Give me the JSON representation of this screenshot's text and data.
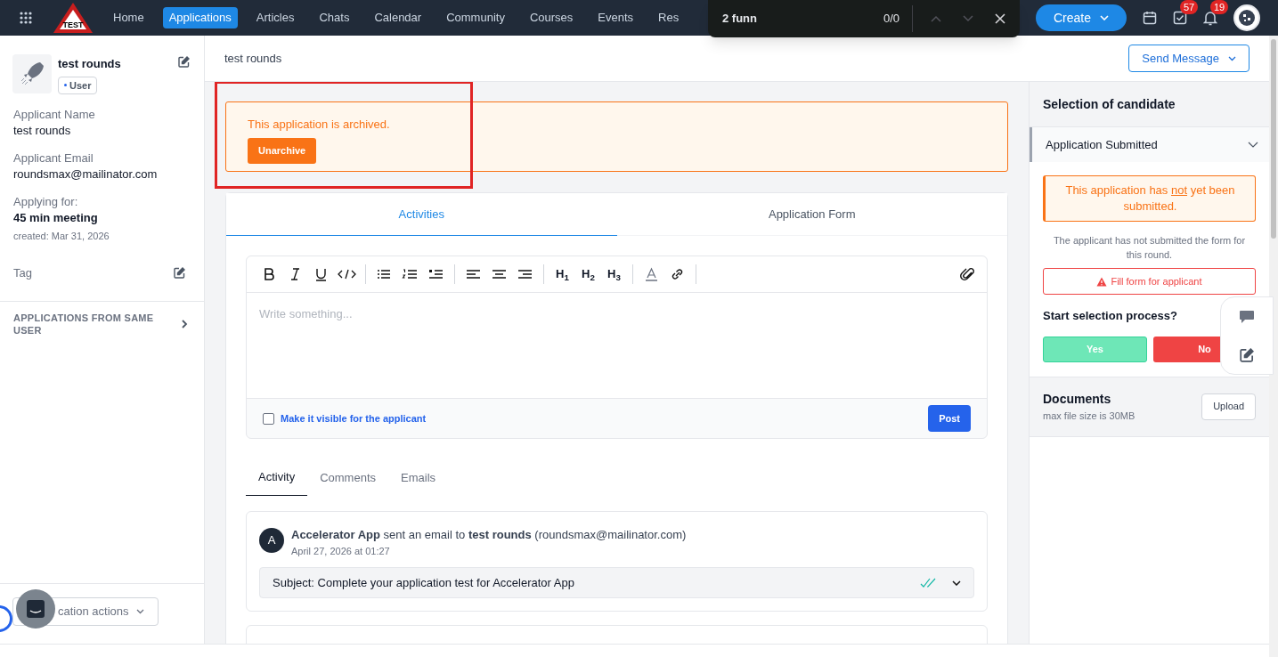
{
  "nav": {
    "items": [
      {
        "label": "Home",
        "selected": false
      },
      {
        "label": "Applications",
        "selected": true
      },
      {
        "label": "Articles",
        "selected": false
      },
      {
        "label": "Chats",
        "selected": false
      },
      {
        "label": "Calendar",
        "selected": false
      },
      {
        "label": "Community",
        "selected": false
      },
      {
        "label": "Courses",
        "selected": false
      },
      {
        "label": "Events",
        "selected": false
      },
      {
        "label": "Res",
        "selected": false
      }
    ],
    "logo": "TEST",
    "create": "Create",
    "tasks_badge": "57",
    "notifications_badge": "19"
  },
  "find_bar": {
    "query": "2 funn",
    "count": "0/0"
  },
  "header": {
    "title": "test rounds",
    "send_message": "Send Message"
  },
  "sidebar": {
    "name": "test rounds",
    "role": "User",
    "fields": [
      {
        "label": "Applicant Name",
        "value": "test rounds"
      },
      {
        "label": "Applicant Email",
        "value": "roundsmax@mailinator.com"
      },
      {
        "label": "Applying for:",
        "value": "45 min meeting",
        "note": "created: Mar 31, 2026"
      }
    ],
    "tag": "Tag",
    "same_user": "APPLICATIONS FROM SAME USER",
    "actions_button": "cation actions"
  },
  "archived_notice": {
    "text": "This application is archived.",
    "button": "Unarchive"
  },
  "tabs": [
    {
      "label": "Activities",
      "selected": true
    },
    {
      "label": "Application Form",
      "selected": false
    }
  ],
  "editor": {
    "headings": [
      "H$_{1}$",
      "H$_{2}$",
      "H$_{3}$"
    ],
    "placeholder": "Write something...",
    "visible_label": "Make it visible for the applicant",
    "visible_checked": false,
    "post": "Post"
  },
  "activity_tabs": [
    {
      "label": "Activity",
      "selected": true
    },
    {
      "label": "Comments",
      "selected": false
    },
    {
      "label": "Emails",
      "selected": false
    }
  ],
  "activities": [
    {
      "avatar": "A",
      "text": "**Accelerator App** sent an email to **test rounds** (roundsmax@mailinator.com)",
      "time": "April 27, 2026 at 01:27",
      "subject": "Subject: Complete your application test for Accelerator App"
    }
  ],
  "selection": {
    "title": "Selection of candidate",
    "stage": "Application Submitted",
    "warning_before": "This application has ",
    "warning_emphasis": "not",
    "warning_after": " yet been submitted.",
    "note": "The applicant has not submitted the form for this round.",
    "fill_button": "Fill form for applicant",
    "question": "Start selection process?",
    "yes": "Yes",
    "no": "No"
  },
  "documents": {
    "title": "Documents",
    "note": "max file size is 30MB",
    "upload": "Upload"
  }
}
